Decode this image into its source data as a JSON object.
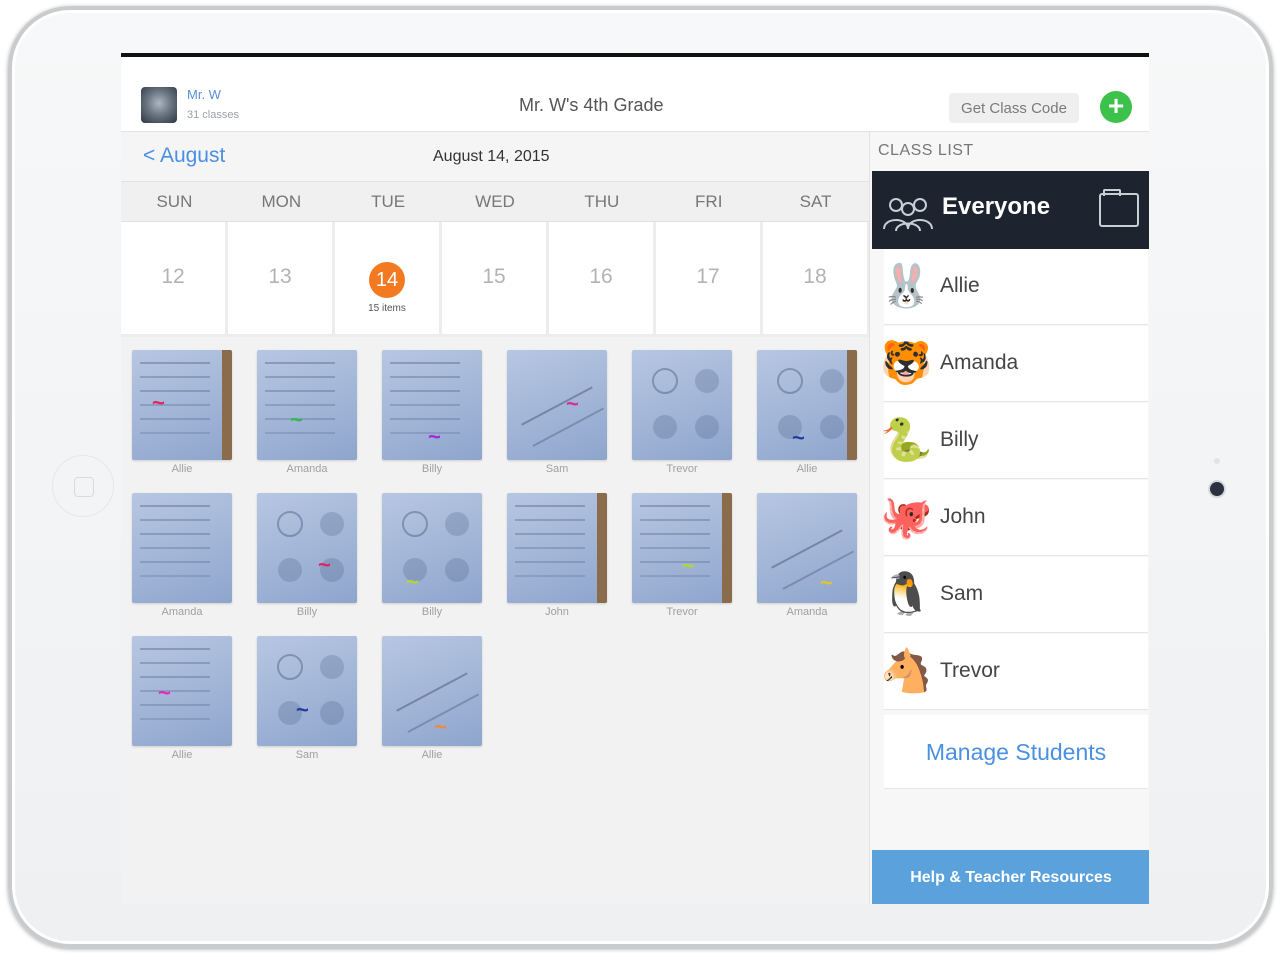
{
  "topbar": {
    "user_name": "Mr. W",
    "user_sub": "31 classes",
    "class_title": "Mr. W's 4th Grade",
    "class_code_label": "Get Class Code",
    "add_label": "+"
  },
  "calendar": {
    "back_label": "< August",
    "date_title": "August 14, 2015",
    "days": [
      "SUN",
      "MON",
      "TUE",
      "WED",
      "THU",
      "FRI",
      "SAT"
    ],
    "dates": [
      "12",
      "13",
      "14",
      "15",
      "16",
      "17",
      "18"
    ],
    "today_items": "15 items"
  },
  "work_items": [
    {
      "student": "Allie",
      "style": "sheet",
      "mark": "#e0245e"
    },
    {
      "student": "Amanda",
      "style": "grid",
      "mark": "#2dbd4a"
    },
    {
      "student": "Billy",
      "style": "grid",
      "mark": "#9c2bd6"
    },
    {
      "student": "Sam",
      "style": "lines",
      "mark": "#d62b9c"
    },
    {
      "student": "Trevor",
      "style": "circles",
      "mark": ""
    },
    {
      "student": "Allie",
      "style": "circles",
      "mark": "#1f3d9c"
    },
    {
      "student": "Amanda",
      "style": "sheet",
      "mark": ""
    },
    {
      "student": "Billy",
      "style": "circles",
      "mark": "#e0245e"
    },
    {
      "student": "Billy",
      "style": "circles",
      "mark": "#b6d62b"
    },
    {
      "student": "John",
      "style": "sheet",
      "mark": ""
    },
    {
      "student": "Trevor",
      "style": "sheet",
      "mark": "#b6d62b"
    },
    {
      "student": "Amanda",
      "style": "lines",
      "mark": "#e0c62b"
    },
    {
      "student": "Allie",
      "style": "sheet",
      "mark": "#e02bb8"
    },
    {
      "student": "Sam",
      "style": "circles",
      "mark": "#1f3d9c"
    },
    {
      "student": "Allie",
      "style": "lines",
      "mark": "#f08a3a"
    }
  ],
  "class_list": {
    "header": "CLASS LIST",
    "everyone_label": "Everyone",
    "students": [
      {
        "name": "Allie",
        "icon": "rabbit-icon",
        "glyph": "🐰"
      },
      {
        "name": "Amanda",
        "icon": "tiger-icon",
        "glyph": "🐯"
      },
      {
        "name": "Billy",
        "icon": "snake-icon",
        "glyph": "🐍"
      },
      {
        "name": "John",
        "icon": "octopus-icon",
        "glyph": "🐙"
      },
      {
        "name": "Sam",
        "icon": "penguin-icon",
        "glyph": "🐧"
      },
      {
        "name": "Trevor",
        "icon": "horse-icon",
        "glyph": "🐴"
      }
    ],
    "manage_label": "Manage Students",
    "help_label": "Help & Teacher Resources"
  },
  "colors": {
    "accent": "#4a90e2",
    "today": "#f47a22",
    "add": "#3cc24a",
    "everyone_bg": "#1d2430",
    "help_bg": "#5ba2dd"
  }
}
